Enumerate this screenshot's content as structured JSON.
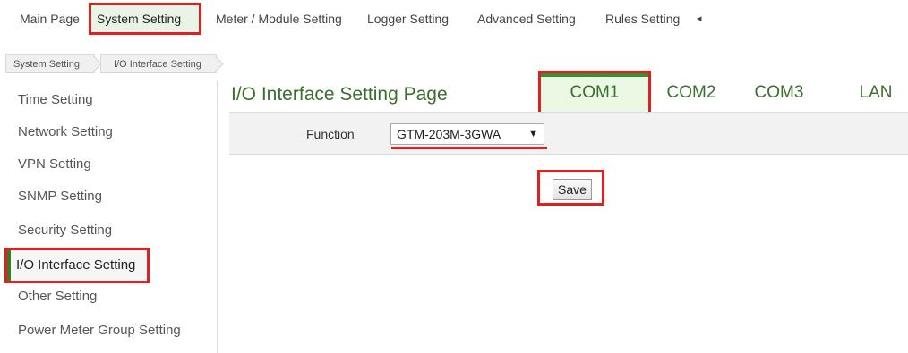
{
  "topnav": {
    "items": [
      "Main Page",
      "System Setting",
      "Meter / Module Setting",
      "Logger Setting",
      "Advanced Setting",
      "Rules Setting"
    ],
    "more_icon": "◂"
  },
  "breadcrumb": [
    "System Setting",
    "I/O Interface Setting"
  ],
  "sidebar": {
    "items": [
      "Time Setting",
      "Network Setting",
      "VPN Setting",
      "SNMP Setting",
      "Security Setting",
      "I/O Interface Setting",
      "Other Setting",
      "Power Meter Group Setting"
    ]
  },
  "main": {
    "title": "I/O Interface Setting Page",
    "tabs": [
      "COM1",
      "COM2",
      "COM3",
      "LAN"
    ],
    "function_label": "Function",
    "function_value": "GTM-203M-3GWA",
    "save_label": "Save"
  },
  "colors": {
    "accent": "#3a6e2e",
    "highlight": "#e02020",
    "active_tab_bg": "#eaf8e4"
  }
}
